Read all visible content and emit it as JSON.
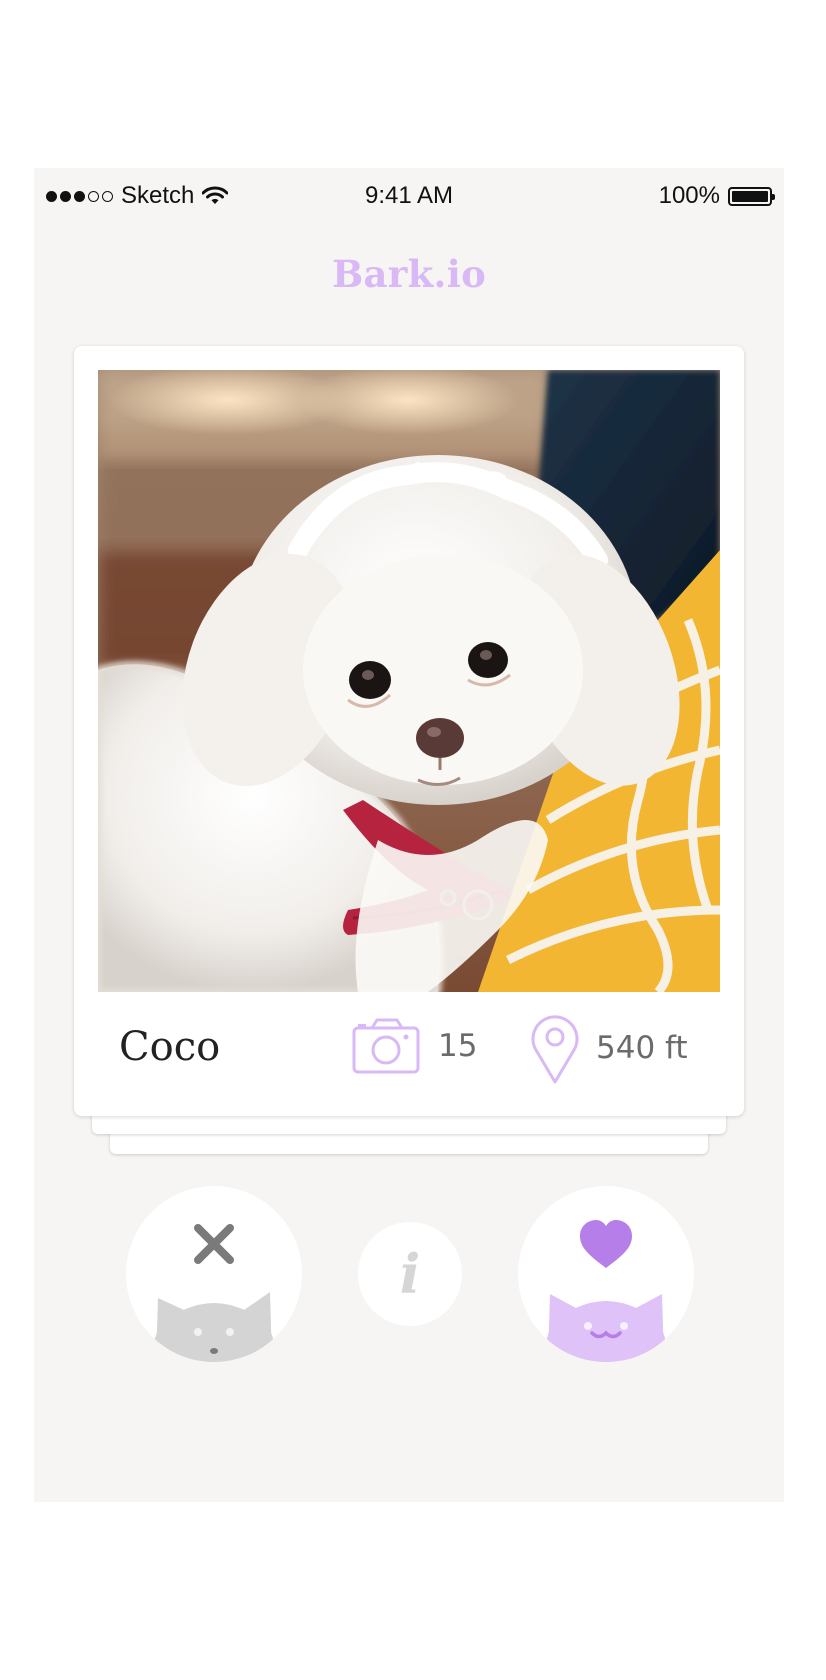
{
  "status_bar": {
    "carrier": "Sketch",
    "time": "9:41 AM",
    "battery": "100%",
    "signal_bars_filled": 3,
    "signal_bars_total": 5
  },
  "header": {
    "title": "Bark.io"
  },
  "profile_card": {
    "name": "Coco",
    "photo_count": "15",
    "distance": "540 ft",
    "photo_subject": "white Maltese puppy with red collar on yellow patterned pillow"
  },
  "actions": {
    "dislike": {
      "icon": "x-icon"
    },
    "info": {
      "label": "i"
    },
    "like": {
      "icon": "heart-icon"
    }
  },
  "colors": {
    "accent": "#d8b9f5",
    "heart": "#b57ee8",
    "background": "#f6f5f3",
    "stat_text": "#6b6b6b",
    "dislike_face": "#d4d4d4",
    "like_face": "#dfc2f7"
  }
}
